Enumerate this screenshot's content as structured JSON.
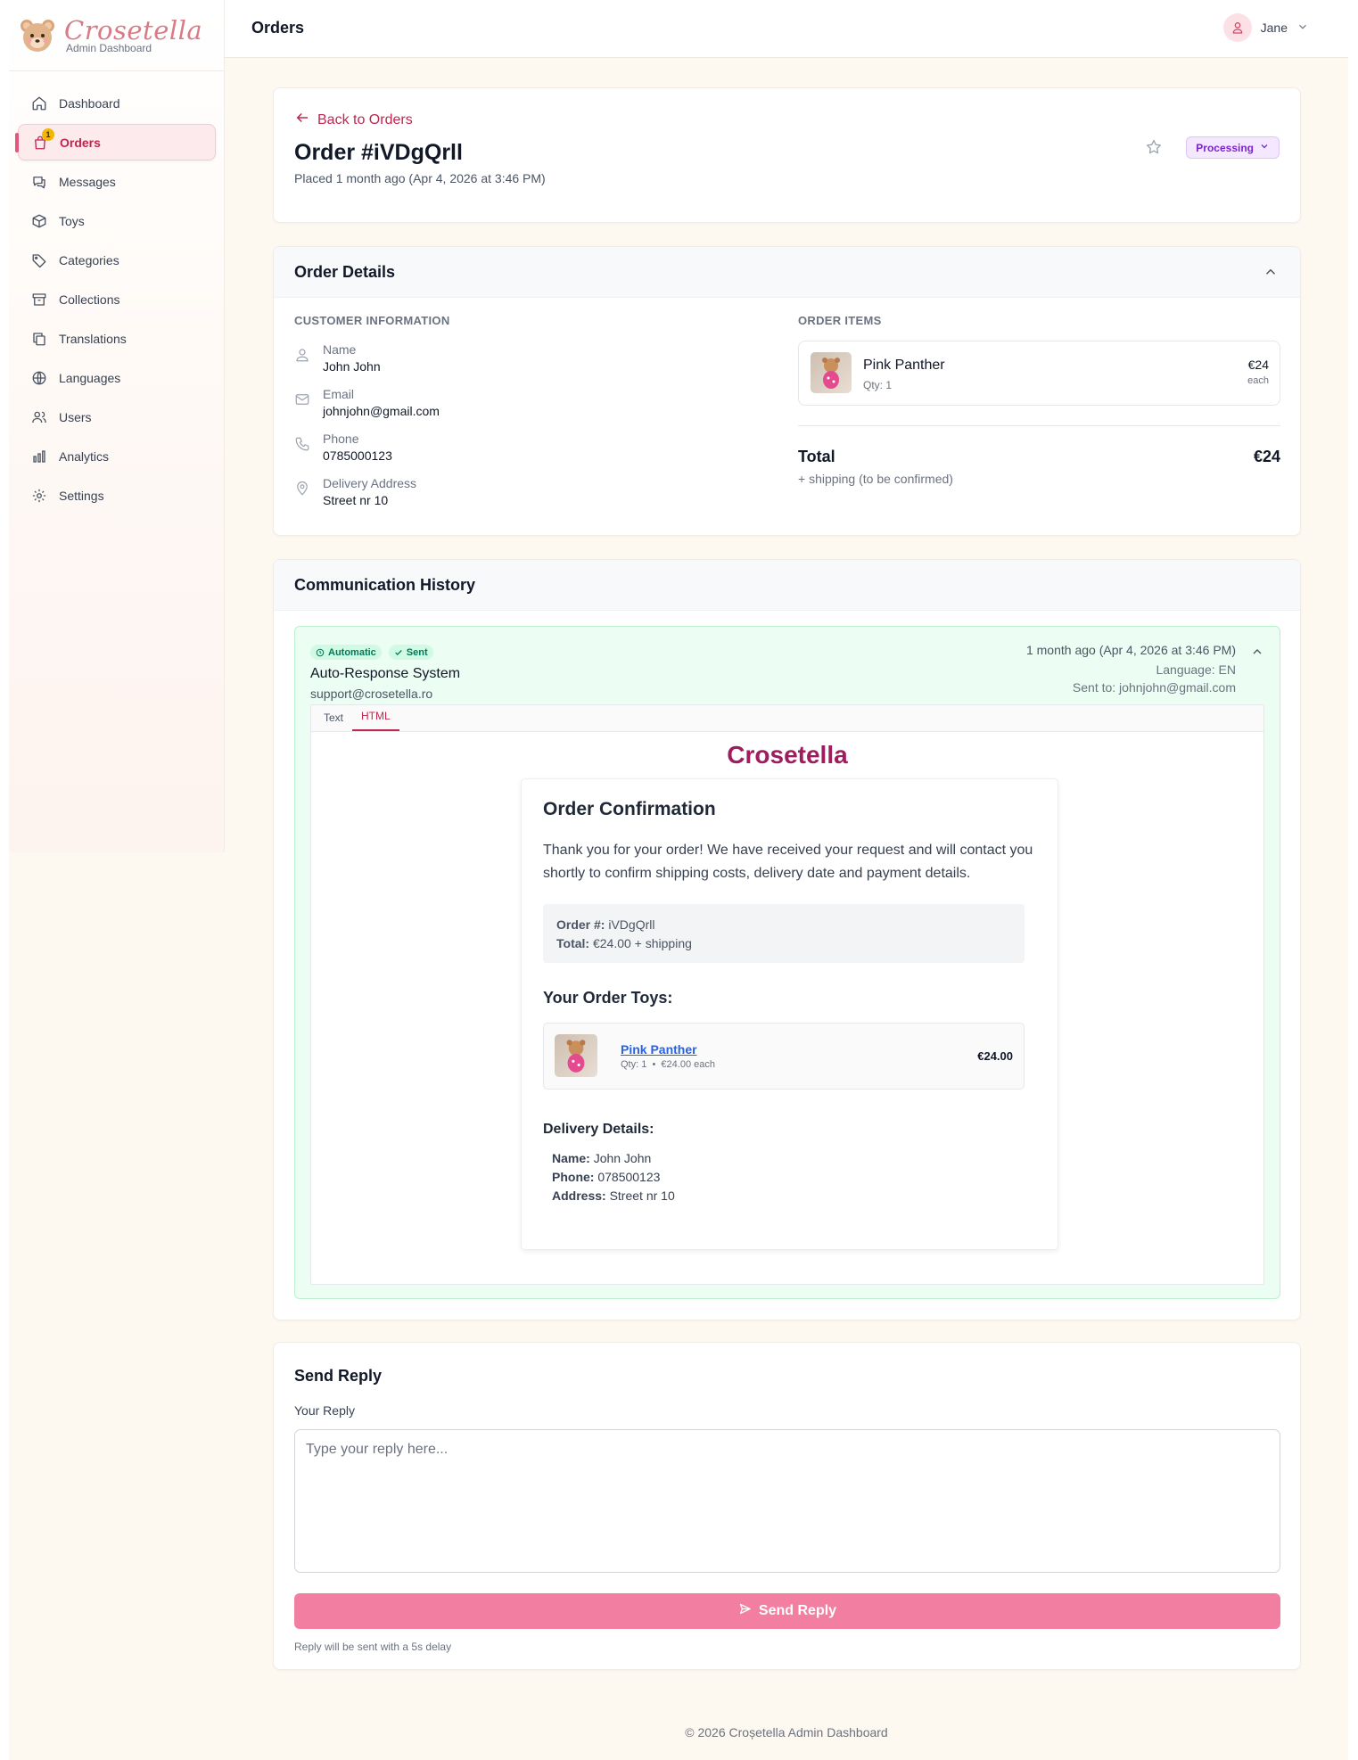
{
  "brand": {
    "name": "Crosetella",
    "subtitle": "Admin Dashboard"
  },
  "sidebar": {
    "items": [
      {
        "label": "Dashboard",
        "icon": "home-icon"
      },
      {
        "label": "Orders",
        "icon": "shopping-bag-icon",
        "badge": "1",
        "active": true
      },
      {
        "label": "Messages",
        "icon": "chat-icon"
      },
      {
        "label": "Toys",
        "icon": "box-icon"
      },
      {
        "label": "Categories",
        "icon": "tag-icon"
      },
      {
        "label": "Collections",
        "icon": "archive-icon"
      },
      {
        "label": "Translations",
        "icon": "copy-icon"
      },
      {
        "label": "Languages",
        "icon": "globe-icon"
      },
      {
        "label": "Users",
        "icon": "users-icon"
      },
      {
        "label": "Analytics",
        "icon": "bar-chart-icon"
      },
      {
        "label": "Settings",
        "icon": "gear-icon"
      }
    ]
  },
  "header": {
    "title": "Orders",
    "user": "Jane"
  },
  "order": {
    "back_label": "Back to Orders",
    "title": "Order #iVDgQrll",
    "placed": "Placed 1 month ago (Apr 4, 2026 at 3:46 PM)",
    "status": "Processing"
  },
  "details": {
    "title": "Order Details",
    "customer_label": "CUSTOMER INFORMATION",
    "customer": {
      "name_label": "Name",
      "name": "John John",
      "email_label": "Email",
      "email": "johnjohn@gmail.com",
      "phone_label": "Phone",
      "phone": "0785000123",
      "address_label": "Delivery Address",
      "address": "Street nr 10"
    },
    "items_label": "ORDER ITEMS",
    "items": [
      {
        "name": "Pink Panther",
        "qty": "Qty: 1",
        "price": "€24",
        "unit": "each"
      }
    ],
    "total_label": "Total",
    "total": "€24",
    "shipping_note": "+ shipping (to be confirmed)"
  },
  "communication": {
    "title": "Communication History",
    "tag_automatic": "Automatic",
    "tag_sent": "Sent",
    "sender": "Auto-Response System",
    "sender_email": "support@crosetella.ro",
    "time": "1 month ago (Apr 4, 2026 at 3:46 PM)",
    "language": "Language: EN",
    "sent_to": "Sent to: johnjohn@gmail.com",
    "tabs": [
      "Text",
      "HTML"
    ],
    "active_tab": "HTML"
  },
  "email": {
    "logo": "Crosetella",
    "heading": "Order Confirmation",
    "body": "Thank you for your order! We have received your request and will contact you shortly to confirm shipping costs, delivery date and payment details.",
    "order_no_label": "Order #:",
    "order_no": "iVDgQrll",
    "total_label": "Total:",
    "total": "€24.00 + shipping",
    "toys_heading": "Your Order Toys:",
    "toy_name": "Pink Panther",
    "toy_meta": "Qty: 1  •  €24.00 each",
    "toy_price": "€24.00",
    "delivery_heading": "Delivery Details:",
    "name_label": "Name:",
    "name": "John John",
    "phone_label": "Phone:",
    "phone": "078500123",
    "address_label": "Address:",
    "address": "Street nr 10"
  },
  "reply": {
    "title": "Send Reply",
    "label": "Your Reply",
    "placeholder": "Type your reply here...",
    "button": "Send Reply",
    "note": "Reply will be sent with a 5s delay"
  },
  "footer": "© 2026 Croșetella Admin Dashboard",
  "colors": {
    "accent": "#c0264f",
    "send_button": "#f27ea2",
    "status_bg": "#f3e8ff",
    "comm_bg": "#ecfdf3"
  }
}
